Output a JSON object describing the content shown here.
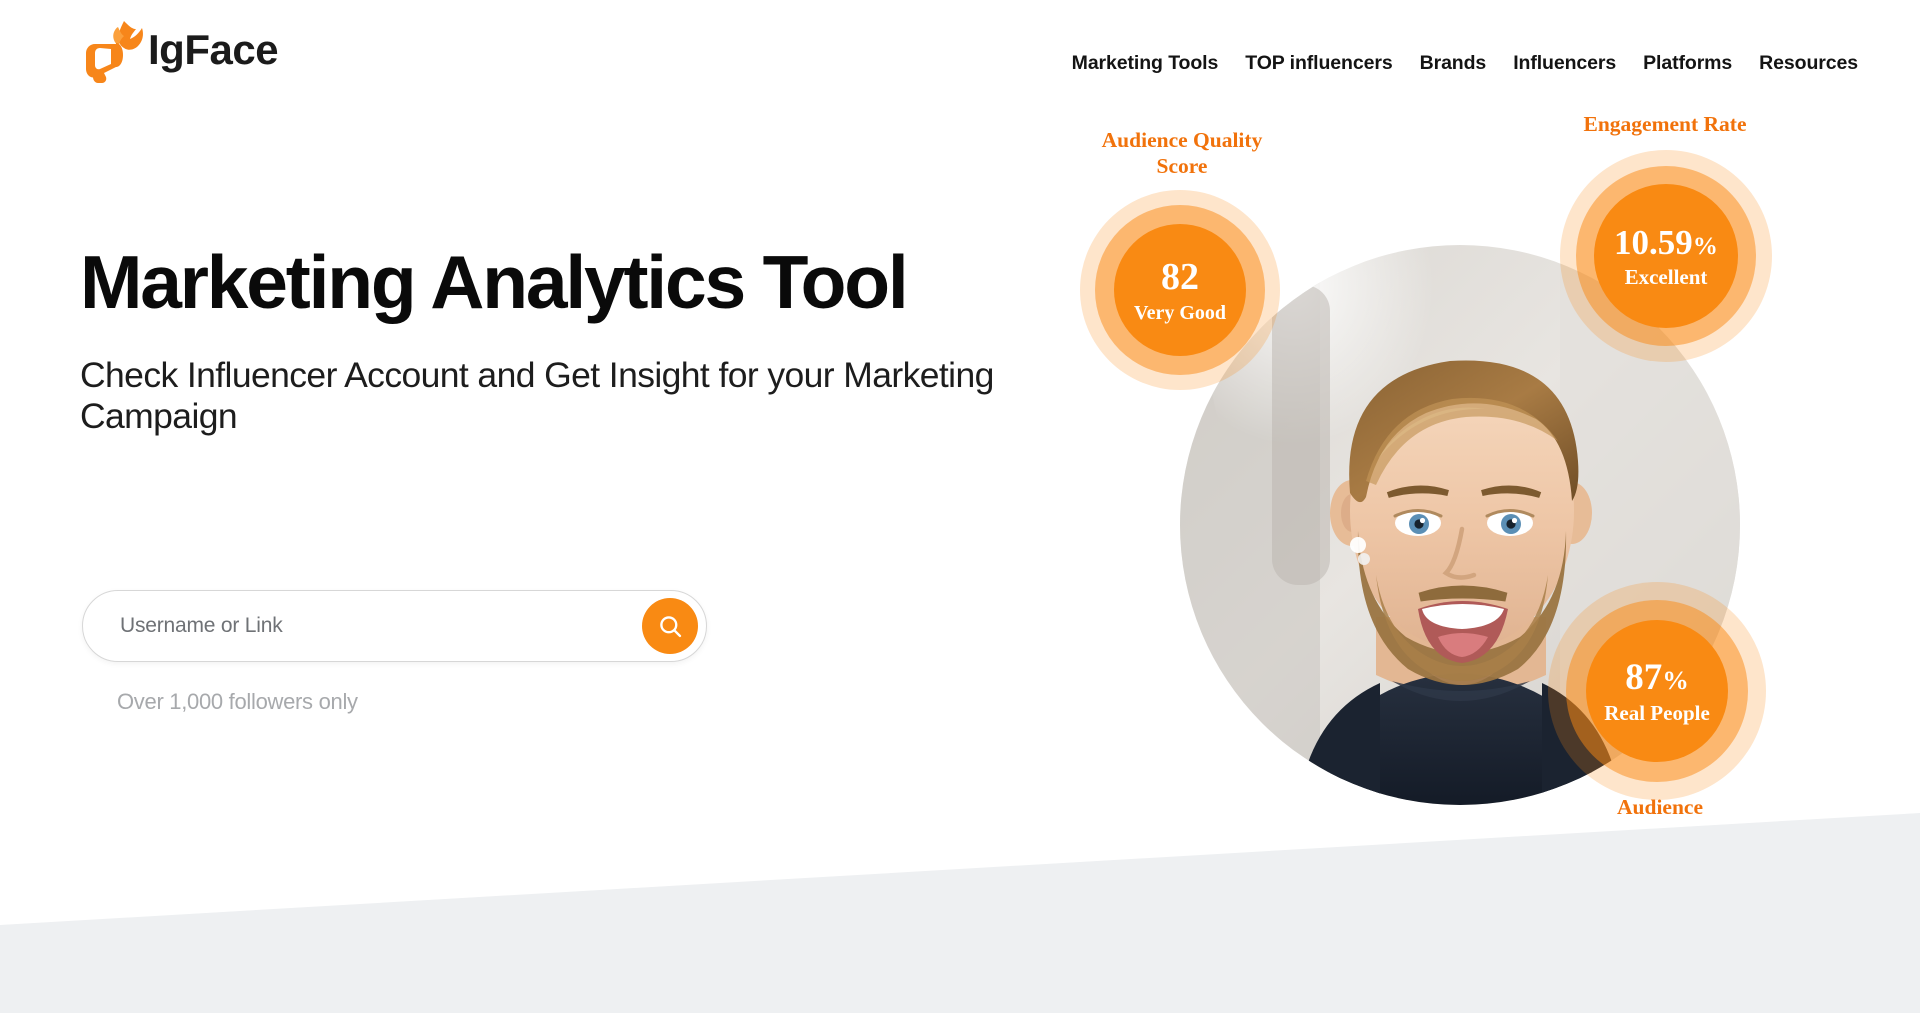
{
  "brand": {
    "name": "IgFace",
    "logo_icon": "megaphone-flame-icon",
    "accent_color": "#f98a13",
    "accent_dark_color": "#f1720b"
  },
  "nav": {
    "items": [
      {
        "label": "Marketing Tools"
      },
      {
        "label": "TOP influencers"
      },
      {
        "label": "Brands"
      },
      {
        "label": "Influencers"
      },
      {
        "label": "Platforms"
      },
      {
        "label": "Resources"
      }
    ]
  },
  "hero": {
    "title": "Marketing Analytics Tool",
    "subtitle": "Check Influencer Account and Get\nInsight for your Marketing Campaign"
  },
  "search": {
    "placeholder": "Username or Link",
    "value": "",
    "button_icon": "search-icon",
    "hint": "Over 1,000 followers only"
  },
  "metrics": [
    {
      "id": "audience-quality-score",
      "caption": "Audience Quality\nScore",
      "value": "82",
      "suffix": "",
      "label": "Very Good"
    },
    {
      "id": "engagement-rate",
      "caption": "Engagement Rate",
      "value": "10.59",
      "suffix": "%",
      "label": "Excellent"
    },
    {
      "id": "audience",
      "caption": "Audience",
      "value": "87",
      "suffix": "%",
      "label": "Real People"
    }
  ],
  "photo": {
    "alt": "smiling-bearded-man-portrait"
  }
}
